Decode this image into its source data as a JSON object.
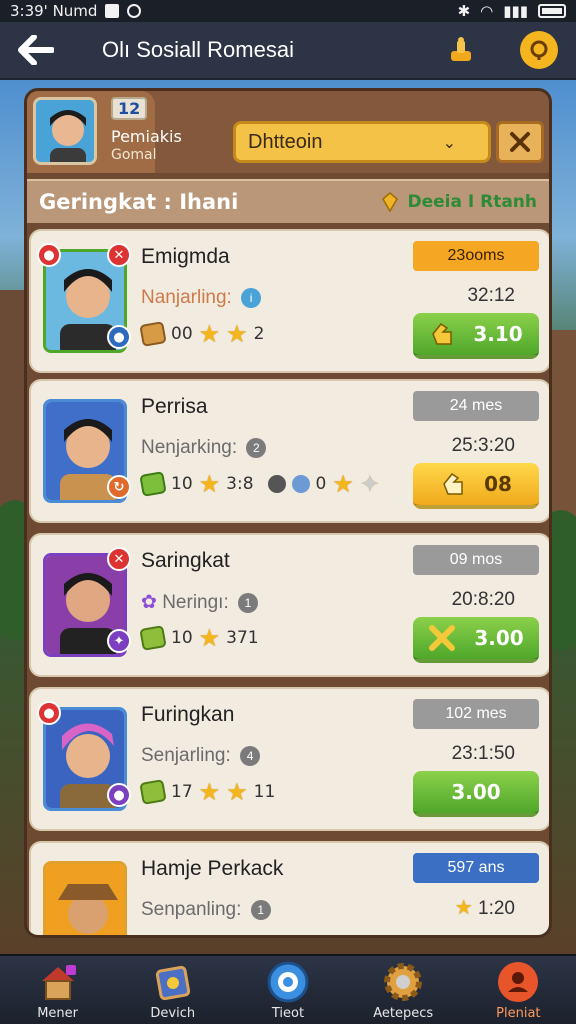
{
  "statusbar": {
    "time": "3:39' Numd"
  },
  "topbar": {
    "title": "Olı Sosiall Romesai"
  },
  "me": {
    "badge": "12",
    "name": "Pemiakis",
    "sub": "Gomal"
  },
  "filter": {
    "value": "Dhtteoin"
  },
  "section": {
    "title": "Geringkat : Ihani",
    "right_label": "Deeia I Rtanh"
  },
  "players": [
    {
      "name": "Emigmda",
      "rank_label": "Nanjarling:",
      "time_badge": "23ooms",
      "timer": "32:12",
      "gem_value": "00",
      "star_value": "2",
      "button": "3.10",
      "badge_color": "#f5a623",
      "button_style": "green"
    },
    {
      "name": "Perrisa",
      "rank_label": "Nenjarking:",
      "rank_num": "2",
      "time_badge": "24 mes",
      "timer": "25:3:20",
      "gem_value": "10",
      "star_value": "3:8",
      "extra_value": "0",
      "button": "08",
      "badge_color": "#9a9a9a",
      "button_style": "yellow"
    },
    {
      "name": "Saringkat",
      "rank_label": "Neringı:",
      "rank_num": "1",
      "time_badge": "09 mos",
      "timer": "20:8:20",
      "gem_value": "10",
      "star_value": "371",
      "button": "3.00",
      "badge_color": "#9a9a9a",
      "button_style": "green"
    },
    {
      "name": "Furingkan",
      "rank_label": "Senjarling:",
      "rank_num": "4",
      "time_badge": "102 mes",
      "timer": "23:1:50",
      "gem_value": "17",
      "star_value": "11",
      "button": "3.00",
      "badge_color": "#9a9a9a",
      "button_style": "green"
    },
    {
      "name": "Hamje Perkack",
      "rank_label": "Senpanling:",
      "rank_num": "1",
      "time_badge": "597 ans",
      "timer": "1:20",
      "button": "",
      "badge_color": "#3a6fc4",
      "button_style": "green"
    }
  ],
  "nav": [
    {
      "label": "Mener",
      "icon": "home-icon"
    },
    {
      "label": "Devich",
      "icon": "map-icon"
    },
    {
      "label": "Tieot",
      "icon": "target-icon"
    },
    {
      "label": "Aetepecs",
      "icon": "gear-icon"
    },
    {
      "label": "Pleniat",
      "icon": "profile-icon"
    }
  ],
  "colors": {
    "green": "#4fa72a",
    "yellow": "#f0a91c",
    "panel": "#6e4a32",
    "accent": "#f3c246"
  }
}
